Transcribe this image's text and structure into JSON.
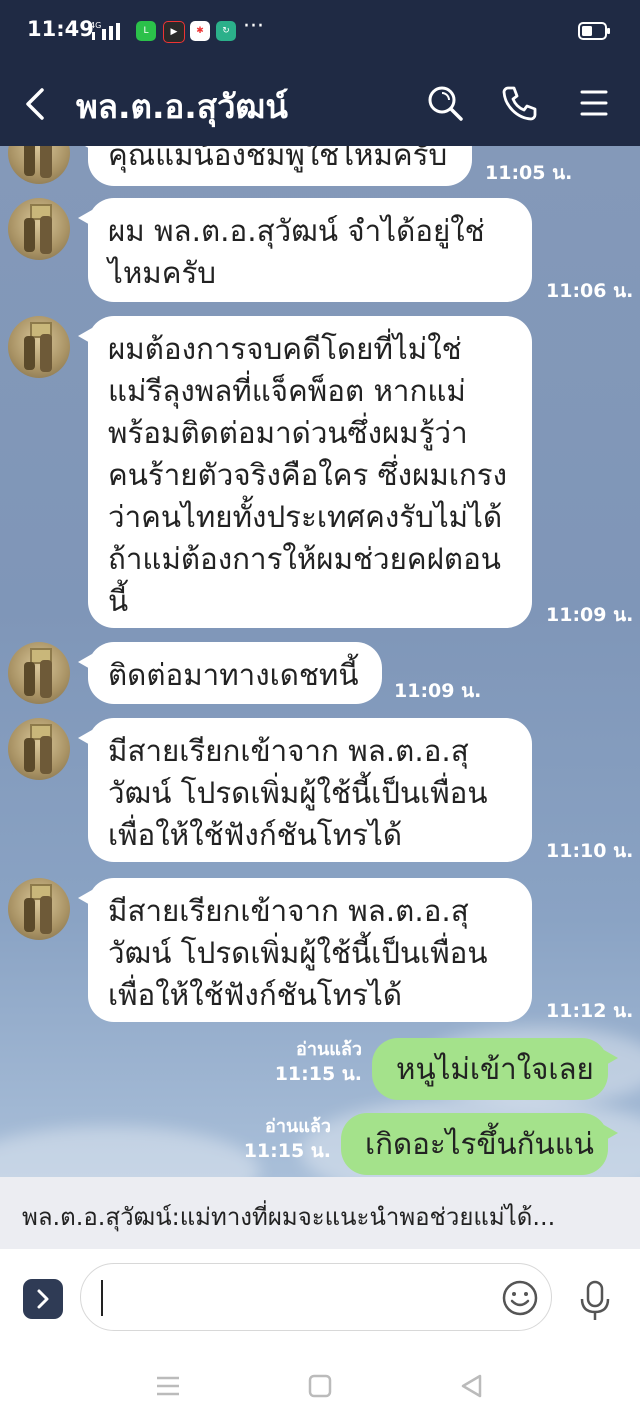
{
  "status_bar": {
    "time": "11:49",
    "network": "4G",
    "app_icons": [
      "line-app-icon",
      "youtube-app-icon",
      "photos-app-icon",
      "refresh-app-icon"
    ],
    "more": "···"
  },
  "header": {
    "title": "พล.ต.อ.สุวัฒน์",
    "icons": [
      "back-arrow-icon",
      "search-icon",
      "phone-icon",
      "menu-icon"
    ]
  },
  "messages": [
    {
      "direction": "in",
      "lines": [
        "คุณแม่น้องชมพู่ใช่ไหมครับ"
      ],
      "time": "11:05 น."
    },
    {
      "direction": "in",
      "lines": [
        "ผม พล.ต.อ.สุวัฒน์ จำได้อยู่ใช่",
        "ไหมครับ"
      ],
      "time": "11:06 น."
    },
    {
      "direction": "in",
      "lines": [
        "ผมต้องการจบคดีโดยที่ไม่ใช่",
        "แม่รีลุงพลที่แจ็คพ็อต หากแม่",
        "พร้อมติดต่อมาด่วนซึ่งผมรู้ว่า",
        "คนร้ายตัวจริงคือใคร ซึ่งผมเกรง",
        "ว่าคนไทยทั้งประเทศคงรับไม่ได้",
        "ถ้าแม่ต้องการให้ผมช่วยคฝตอน",
        "นี้"
      ],
      "time": "11:09 น."
    },
    {
      "direction": "in",
      "lines": [
        "ติดต่อมาทางเดชทนี้"
      ],
      "time": "11:09 น."
    },
    {
      "direction": "in",
      "lines": [
        "มีสายเรียกเข้าจาก พล.ต.อ.สุ",
        "วัฒน์ โปรดเพิ่มผู้ใช้นี้เป็นเพื่อน",
        "เพื่อให้ใช้ฟังก์ชันโทรได้"
      ],
      "time": "11:10 น."
    },
    {
      "direction": "in",
      "lines": [
        "มีสายเรียกเข้าจาก พล.ต.อ.สุ",
        "วัฒน์ โปรดเพิ่มผู้ใช้นี้เป็นเพื่อน",
        "เพื่อให้ใช้ฟังก์ชันโทรได้"
      ],
      "time": "11:12 น."
    },
    {
      "direction": "out",
      "text": "หนูไม่เข้าใจเลย",
      "read": "อ่านแล้ว",
      "time": "11:15 น."
    },
    {
      "direction": "out",
      "text": "เกิดอะไรขึ้นกันแน่",
      "read": "อ่านแล้ว",
      "time": "11:15 น."
    }
  ],
  "notification_preview": "พล.ต.อ.สุวัฒน์:แม่ทางที่ผมจะแนะนำพอช่วยแม่ได้...",
  "input": {
    "value": "",
    "placeholder": ""
  },
  "colors": {
    "header_bg": "#1f2a44",
    "chat_bg": "#7f96b8",
    "incoming_bubble": "#ffffff",
    "outgoing_bubble": "#a4e28b"
  }
}
